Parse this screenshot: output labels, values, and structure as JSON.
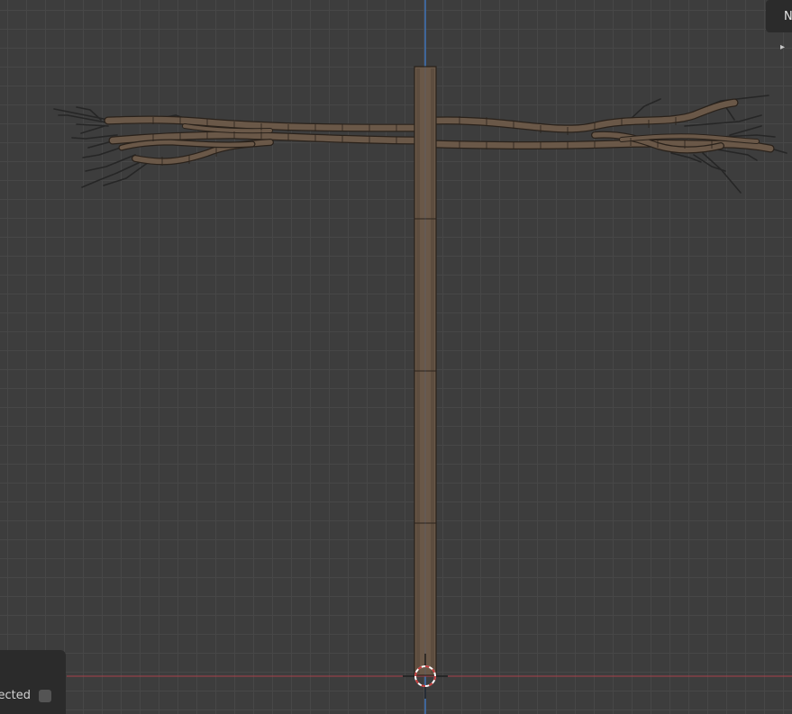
{
  "viewport": {
    "background_color": "#3d3d3d",
    "grid_color": "#474747",
    "x_axis_color": "#a8414a",
    "z_axis_color": "#3e74b9",
    "bark_color": "#6a5848",
    "bark_edge_color": "#2a221b"
  },
  "n_panel_tab": {
    "label": "N",
    "toggle_icon": "triangle-right-icon",
    "toggle_glyph": "▸"
  },
  "last_operation_panel": {
    "checkbox_label": "Selected",
    "checkbox_checked": false
  },
  "cursor_3d": {
    "icon": "3d-cursor-icon"
  }
}
